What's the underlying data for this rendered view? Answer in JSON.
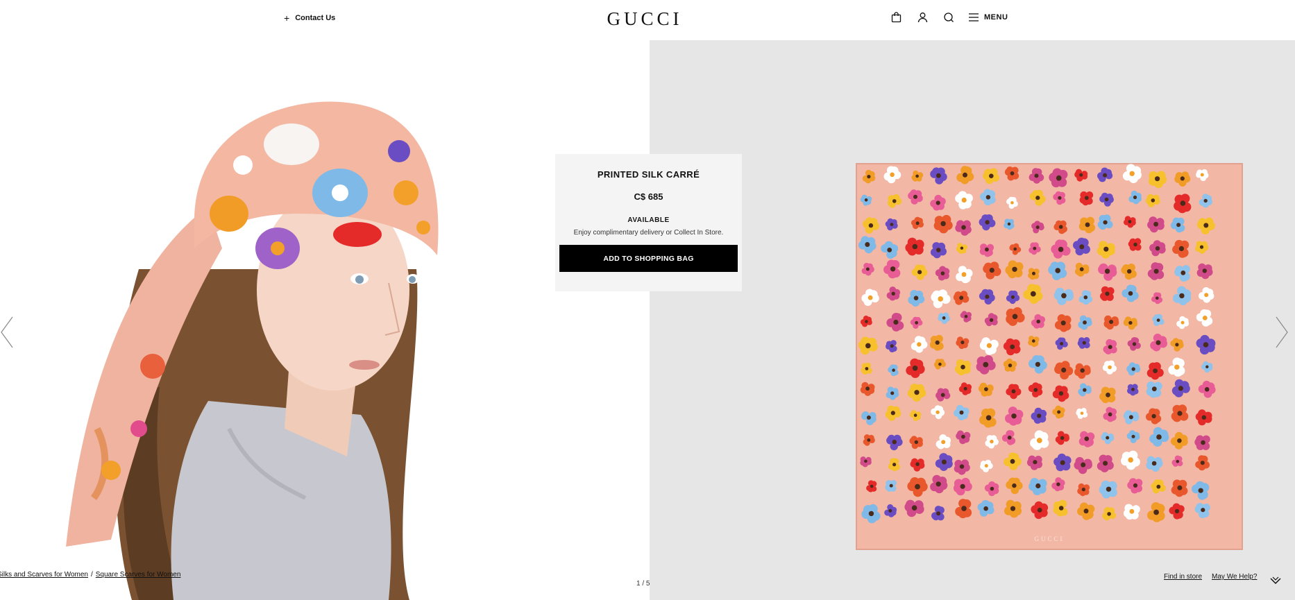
{
  "header": {
    "contact_label": "Contact Us",
    "logo_text": "GUCCI",
    "menu_label": "MENU",
    "icons": [
      "shopping-bag-icon",
      "account-icon",
      "search-icon",
      "hamburger-icon"
    ]
  },
  "product": {
    "name": "PRINTED SILK CARRÉ",
    "price": "C$ 685",
    "availability": "AVAILABLE",
    "delivery_note": "Enjoy complimentary delivery or Collect In Store.",
    "add_button_label": "ADD TO SHOPPING BAG",
    "scarf_logo": "GUCCI"
  },
  "breadcrumb": {
    "items": [
      "Silks and Scarves for Women",
      "Square Scarves for Women"
    ],
    "separator": "/"
  },
  "carousel": {
    "counter": "1 / 5",
    "current": 1,
    "total": 5
  },
  "footer_links": {
    "find_in_store": "Find in store",
    "help": "May We Help?"
  },
  "colors": {
    "accent": "#000000",
    "scarf_background": "#f2b7a5",
    "panel_background": "#e6e6e6",
    "card_background": "#f4f4f4"
  }
}
